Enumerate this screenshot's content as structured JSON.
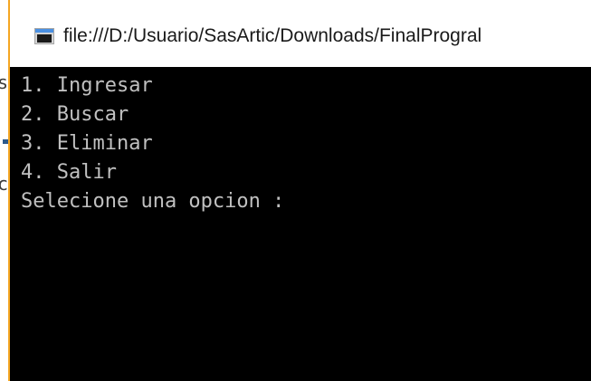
{
  "window": {
    "title": "file:///D:/Usuario/SasArtic/Downloads/FinalProgral"
  },
  "console": {
    "lines": [
      "1. Ingresar",
      "2. Buscar",
      "3. Eliminar",
      "4. Salir",
      "Selecione una opcion :"
    ]
  },
  "background_window": {
    "visible_edge_chars": [
      "s",
      "c"
    ]
  },
  "icons": {
    "window_icon": "console-app-icon"
  },
  "colors": {
    "console_background": "#000000",
    "console_text": "#c0c0c0",
    "focus_border": "#f5a623",
    "titlebar_background": "#ffffff"
  }
}
